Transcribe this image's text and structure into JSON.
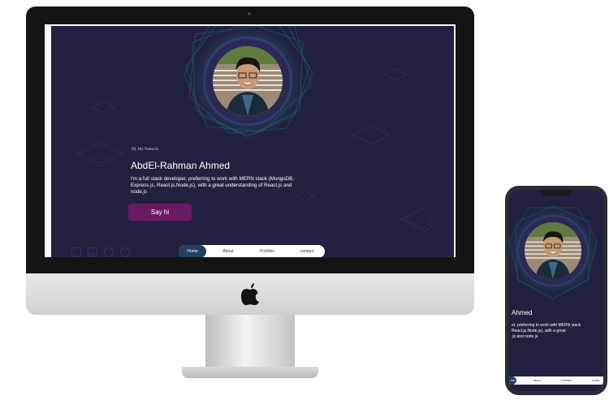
{
  "site": {
    "greeting": "HI, My Name Is",
    "name": "AbdEl-Rahman Ahmed",
    "bio": "I'm a full stack developer, preferring to work with MERN stack (MongoDB, Express.js, React.js,Node.js), with a great understanding of React.js and node.js",
    "cta_label": "Say hi",
    "nav": [
      "Home",
      "About",
      "Portfolio",
      "contact"
    ],
    "active_nav": "Home",
    "socials": [
      "linkedin-icon",
      "instagram-icon",
      "github-icon",
      "whatsapp-icon"
    ]
  },
  "phone": {
    "name_fragment": "Ahmed",
    "bio_lines": [
      "er, preferring to work with MERN stack",
      "React.js,Node.js), with a great",
      ".js and node.js"
    ],
    "nav": [
      "me",
      "About",
      "Portfolio",
      "conta"
    ]
  },
  "colors": {
    "background": "#22203f",
    "accent": "#6a1a63",
    "nav_active": "#243f66"
  }
}
